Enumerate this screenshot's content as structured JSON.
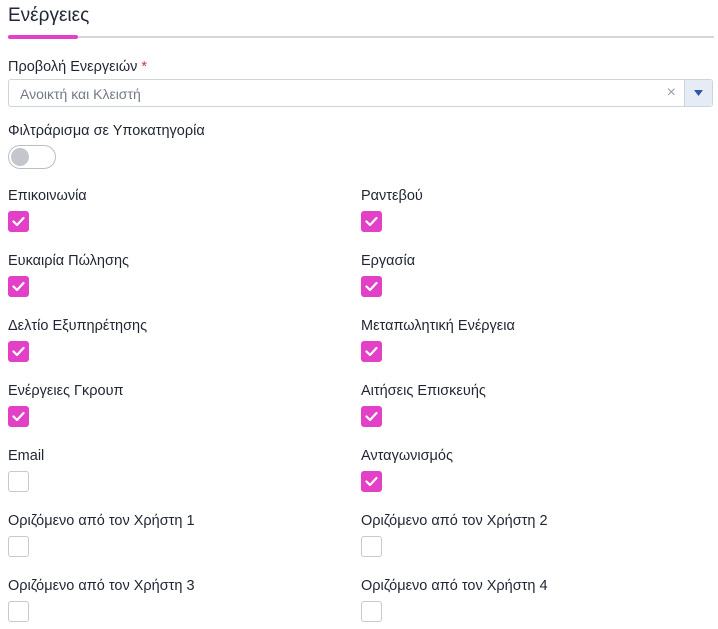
{
  "section": {
    "title": "Ενέργειες"
  },
  "view": {
    "label": "Προβολή Ενεργειών",
    "required_mark": "*",
    "selected_value": "Ανοικτή και Κλειστή",
    "clear_symbol": "×"
  },
  "filter": {
    "label": "Φιλτράρισμα σε Υποκατηγορία",
    "enabled": false
  },
  "options": [
    {
      "label": "Επικοινωνία",
      "checked": true
    },
    {
      "label": "Ραντεβού",
      "checked": true
    },
    {
      "label": "Ευκαιρία Πώλησης",
      "checked": true
    },
    {
      "label": "Εργασία",
      "checked": true
    },
    {
      "label": "Δελτίο Εξυπηρέτησης",
      "checked": true
    },
    {
      "label": "Μεταπωλητική Ενέργεια",
      "checked": true
    },
    {
      "label": "Ενέργειες Γκρουπ",
      "checked": true
    },
    {
      "label": "Αιτήσεις Επισκευής",
      "checked": true
    },
    {
      "label": "Email",
      "checked": false
    },
    {
      "label": "Ανταγωνισμός",
      "checked": true
    },
    {
      "label": "Οριζόμενο από τον Χρήστη 1",
      "checked": false
    },
    {
      "label": "Οριζόμενο από τον Χρήστη 2",
      "checked": false
    },
    {
      "label": "Οριζόμενο από τον Χρήστη 3",
      "checked": false
    },
    {
      "label": "Οριζόμενο από τον Χρήστη 4",
      "checked": false
    }
  ],
  "colors": {
    "accent": "#e241c7",
    "required": "#d8363f"
  },
  "icons": {
    "checkbox_checked": "check-icon",
    "dropdown": "caret-down-icon",
    "clear": "clear-icon"
  }
}
